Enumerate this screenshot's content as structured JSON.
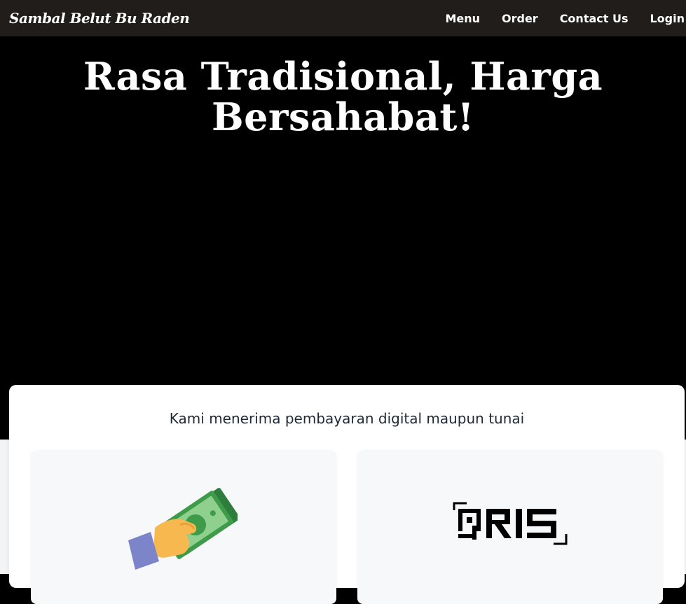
{
  "brand": "Sambal Belut Bu Raden",
  "nav": {
    "items": [
      "Menu",
      "Order",
      "Contact Us",
      "Login"
    ]
  },
  "hero": {
    "title_line1": "Rasa Tradisional, Harga",
    "title_line2": "Bersahabat!"
  },
  "payment": {
    "heading": "Kami menerima pembayaran digital maupun tunai",
    "methods": [
      {
        "icon": "cash-hand-icon"
      },
      {
        "icon": "qris-logo"
      }
    ]
  },
  "colors": {
    "navbar_bg": "#211d1a",
    "hero_bg": "#000000",
    "card_bg": "#ffffff",
    "method_bg": "#f7f8fa",
    "cash_green": "#3d9b4a",
    "hand_yellow": "#f6b84f",
    "sleeve_purple": "#7c85c9"
  }
}
